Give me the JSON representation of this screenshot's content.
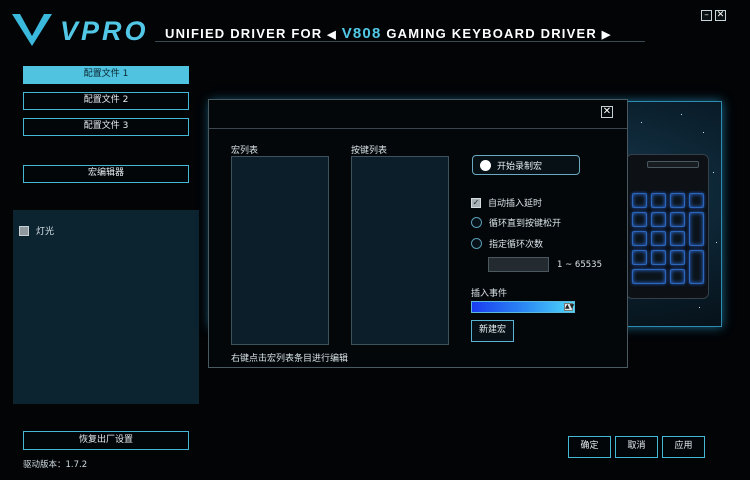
{
  "header": {
    "brand": "VPRO",
    "title_pre": "UNIFIED DRIVER FOR",
    "title_model": "V808",
    "title_post": "GAMING KEYBOARD DRIVER",
    "left_arrow": "◀",
    "right_arrow": "▶"
  },
  "window_controls": {
    "minimize": "–",
    "close": "✕"
  },
  "profiles": [
    "配置文件 1",
    "配置文件 2",
    "配置文件 3"
  ],
  "macro_editor_label": "宏编辑器",
  "left_panel": {
    "light_label": "灯光"
  },
  "reset_label": "恢复出厂设置",
  "version": "驱动版本：1.7.2",
  "dialog": {
    "close": "✕",
    "macro_list_title": "宏列表",
    "key_list_title": "按键列表",
    "hint": "右键点击宏列表条目进行编辑",
    "record_label": "开始录制宏",
    "auto_delay_label": "自动插入延时",
    "loop_until_release_label": "循环直到按键松开",
    "loop_count_label": "指定循环次数",
    "loop_count_value": "",
    "loop_range": "1 ~ 65535",
    "insert_event_label": "插入事件",
    "new_macro_label": "新建宏"
  },
  "bottom_buttons": {
    "ok": "确定",
    "cancel": "取消",
    "apply": "应用"
  }
}
